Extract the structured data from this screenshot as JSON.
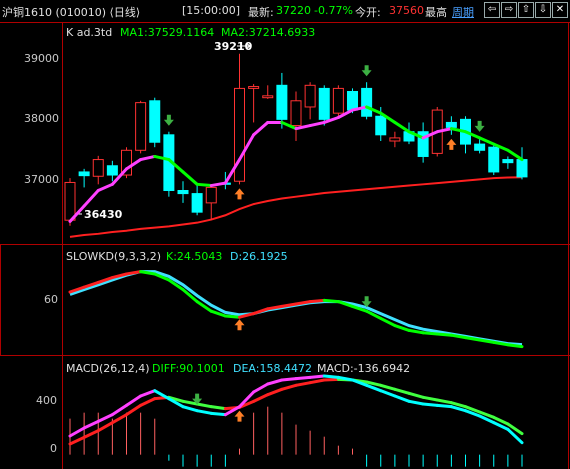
{
  "topbar": {
    "title": "沪铜1610 (010010) ⟨日线⟩",
    "time": "[15:00:00]",
    "latest_label": "最新:",
    "latest_value": "37220",
    "change": "-0.77%",
    "open_label": "今开:",
    "open_value": "37560",
    "high_label": "最高",
    "period_link": "周期",
    "buttons": [
      "⇦",
      "⇨",
      "⇧",
      "⇩",
      "✕"
    ]
  },
  "colors": {
    "up": "#ff3232",
    "down": "#00ffff",
    "ma1": "#00ff00",
    "kline_ma": "#ff40ff",
    "long_ma": "#ff2020",
    "k_line": "#ff2020",
    "d_line": "#40e0ff",
    "diff": "#ff40ff",
    "dea": "#40ff40",
    "axis": "#b00000",
    "text": "#c8c8c8",
    "arrow_up": "#ff7f27",
    "arrow_down": "#3cb043"
  },
  "main_panel": {
    "title": "K  ad.3td",
    "ma1": "MA1:37529.1164",
    "ma2": "MA2:37214.6933",
    "high_mark": "39210",
    "low_mark": "36430",
    "yaxis_labels": [
      "39000",
      "38000",
      "37000"
    ]
  },
  "kd_panel": {
    "title": "SLOWKD(9,3,3,2)",
    "k": "K:24.5043",
    "d": "D:26.1925",
    "yaxis_labels": [
      "60"
    ]
  },
  "macd_panel": {
    "title": "MACD(26,12,4)",
    "diff": "DIFF:90.1001",
    "dea": "DEA:158.4472",
    "macd": "MACD:-136.6942",
    "yaxis_labels": [
      "400",
      "0"
    ]
  },
  "chart_data": {
    "type": "candlestick",
    "candles": [
      {
        "o": 36520,
        "h": 37200,
        "l": 36430,
        "c": 37130
      },
      {
        "o": 37300,
        "h": 37350,
        "l": 37050,
        "c": 37240
      },
      {
        "o": 37230,
        "h": 37560,
        "l": 37100,
        "c": 37500
      },
      {
        "o": 37400,
        "h": 37480,
        "l": 37150,
        "c": 37250
      },
      {
        "o": 37250,
        "h": 37700,
        "l": 37200,
        "c": 37650
      },
      {
        "o": 37650,
        "h": 38450,
        "l": 37600,
        "c": 38420
      },
      {
        "o": 38450,
        "h": 38500,
        "l": 37700,
        "c": 37780
      },
      {
        "o": 37900,
        "h": 37950,
        "l": 36900,
        "c": 37000
      },
      {
        "o": 37000,
        "h": 37150,
        "l": 36800,
        "c": 36950
      },
      {
        "o": 36950,
        "h": 37100,
        "l": 36600,
        "c": 36650
      },
      {
        "o": 36800,
        "h": 37080,
        "l": 36520,
        "c": 37050
      },
      {
        "o": 37120,
        "h": 37300,
        "l": 37020,
        "c": 37100
      },
      {
        "o": 37150,
        "h": 39210,
        "l": 37100,
        "c": 38650
      },
      {
        "o": 38650,
        "h": 38720,
        "l": 38100,
        "c": 38680
      },
      {
        "o": 38500,
        "h": 38700,
        "l": 38480,
        "c": 38530
      },
      {
        "o": 38700,
        "h": 38900,
        "l": 38000,
        "c": 38150
      },
      {
        "o": 38050,
        "h": 38600,
        "l": 37800,
        "c": 38450
      },
      {
        "o": 38350,
        "h": 38750,
        "l": 38150,
        "c": 38700
      },
      {
        "o": 38650,
        "h": 38700,
        "l": 38050,
        "c": 38150
      },
      {
        "o": 38250,
        "h": 38700,
        "l": 38200,
        "c": 38650
      },
      {
        "o": 38600,
        "h": 38650,
        "l": 38250,
        "c": 38300
      },
      {
        "o": 38650,
        "h": 38750,
        "l": 38150,
        "c": 38200
      },
      {
        "o": 38200,
        "h": 38350,
        "l": 37800,
        "c": 37900
      },
      {
        "o": 37800,
        "h": 37950,
        "l": 37700,
        "c": 37850
      },
      {
        "o": 37950,
        "h": 38100,
        "l": 37750,
        "c": 37800
      },
      {
        "o": 37950,
        "h": 38100,
        "l": 37450,
        "c": 37550
      },
      {
        "o": 37600,
        "h": 38350,
        "l": 37550,
        "c": 38300
      },
      {
        "o": 38100,
        "h": 38200,
        "l": 37900,
        "c": 38020
      },
      {
        "o": 38150,
        "h": 38200,
        "l": 37600,
        "c": 37750
      },
      {
        "o": 37750,
        "h": 37850,
        "l": 37600,
        "c": 37650
      },
      {
        "o": 37700,
        "h": 37750,
        "l": 37250,
        "c": 37300
      },
      {
        "o": 37500,
        "h": 37550,
        "l": 37350,
        "c": 37450
      },
      {
        "o": 37500,
        "h": 37700,
        "l": 37180,
        "c": 37220
      }
    ],
    "ma1": [
      37800,
      37750,
      37700,
      37650,
      37600,
      37560,
      37450,
      37250,
      37120,
      37100,
      37150,
      37400,
      37800,
      38100,
      38050,
      38000,
      38050,
      38150,
      38250,
      38380,
      38300,
      38250,
      38150,
      38050,
      37980,
      37950,
      37980,
      37950,
      37900,
      37850,
      37800,
      37700,
      37550
    ],
    "ma2": [
      36500,
      36750,
      37000,
      37100,
      37350,
      37500,
      37550,
      37500,
      37300,
      37100,
      37080,
      37120,
      37500,
      37900,
      38100,
      38100,
      38000,
      38050,
      38100,
      38180,
      38300,
      38350,
      38250,
      38100,
      37950,
      37850,
      37950,
      38000,
      37950,
      37850,
      37750,
      37650,
      37500
    ],
    "long_ma": [
      36250,
      36280,
      36300,
      36330,
      36350,
      36380,
      36400,
      36420,
      36450,
      36480,
      36530,
      36600,
      36700,
      36780,
      36830,
      36870,
      36900,
      36930,
      36960,
      36980,
      37000,
      37020,
      37040,
      37060,
      37080,
      37100,
      37120,
      37140,
      37160,
      37180,
      37200,
      37210,
      37215
    ],
    "kd": {
      "k": [
        70,
        74,
        78,
        82,
        85,
        87,
        85,
        80,
        72,
        62,
        54,
        50,
        49,
        52,
        56,
        58,
        60,
        62,
        63,
        62,
        58,
        54,
        48,
        42,
        38,
        36,
        35,
        34,
        32,
        30,
        28,
        26,
        24.5
      ],
      "d": [
        68,
        72,
        76,
        80,
        84,
        87,
        87,
        83,
        76,
        67,
        59,
        53,
        51,
        52,
        55,
        57,
        59,
        61,
        62,
        62,
        60,
        57,
        52,
        47,
        42,
        39,
        37,
        35,
        33,
        31,
        29,
        27,
        26.2
      ]
    },
    "macd": {
      "diff": [
        140,
        200,
        250,
        300,
        370,
        440,
        480,
        420,
        360,
        330,
        310,
        300,
        360,
        470,
        530,
        560,
        570,
        580,
        590,
        580,
        560,
        520,
        480,
        440,
        400,
        380,
        370,
        360,
        330,
        290,
        240,
        190,
        90
      ],
      "dea": [
        80,
        130,
        180,
        240,
        300,
        370,
        420,
        430,
        400,
        380,
        360,
        345,
        355,
        400,
        450,
        490,
        520,
        540,
        560,
        565,
        560,
        545,
        520,
        490,
        460,
        430,
        410,
        390,
        360,
        320,
        280,
        230,
        158
      ]
    },
    "signals_up": [
      {
        "i": 12,
        "panel": "main"
      },
      {
        "i": 27,
        "panel": "main"
      },
      {
        "i": 12,
        "panel": "kd"
      },
      {
        "i": 12,
        "panel": "macd"
      }
    ],
    "signals_down": [
      {
        "i": 7,
        "panel": "main"
      },
      {
        "i": 21,
        "panel": "main"
      },
      {
        "i": 29,
        "panel": "main"
      },
      {
        "i": 21,
        "panel": "kd"
      },
      {
        "i": 9,
        "panel": "macd"
      }
    ],
    "ylim_main": [
      36200,
      39400
    ],
    "ylim_kd": [
      20,
      95
    ],
    "ylim_macd": [
      -40,
      620
    ],
    "legend_position": "top-left"
  }
}
